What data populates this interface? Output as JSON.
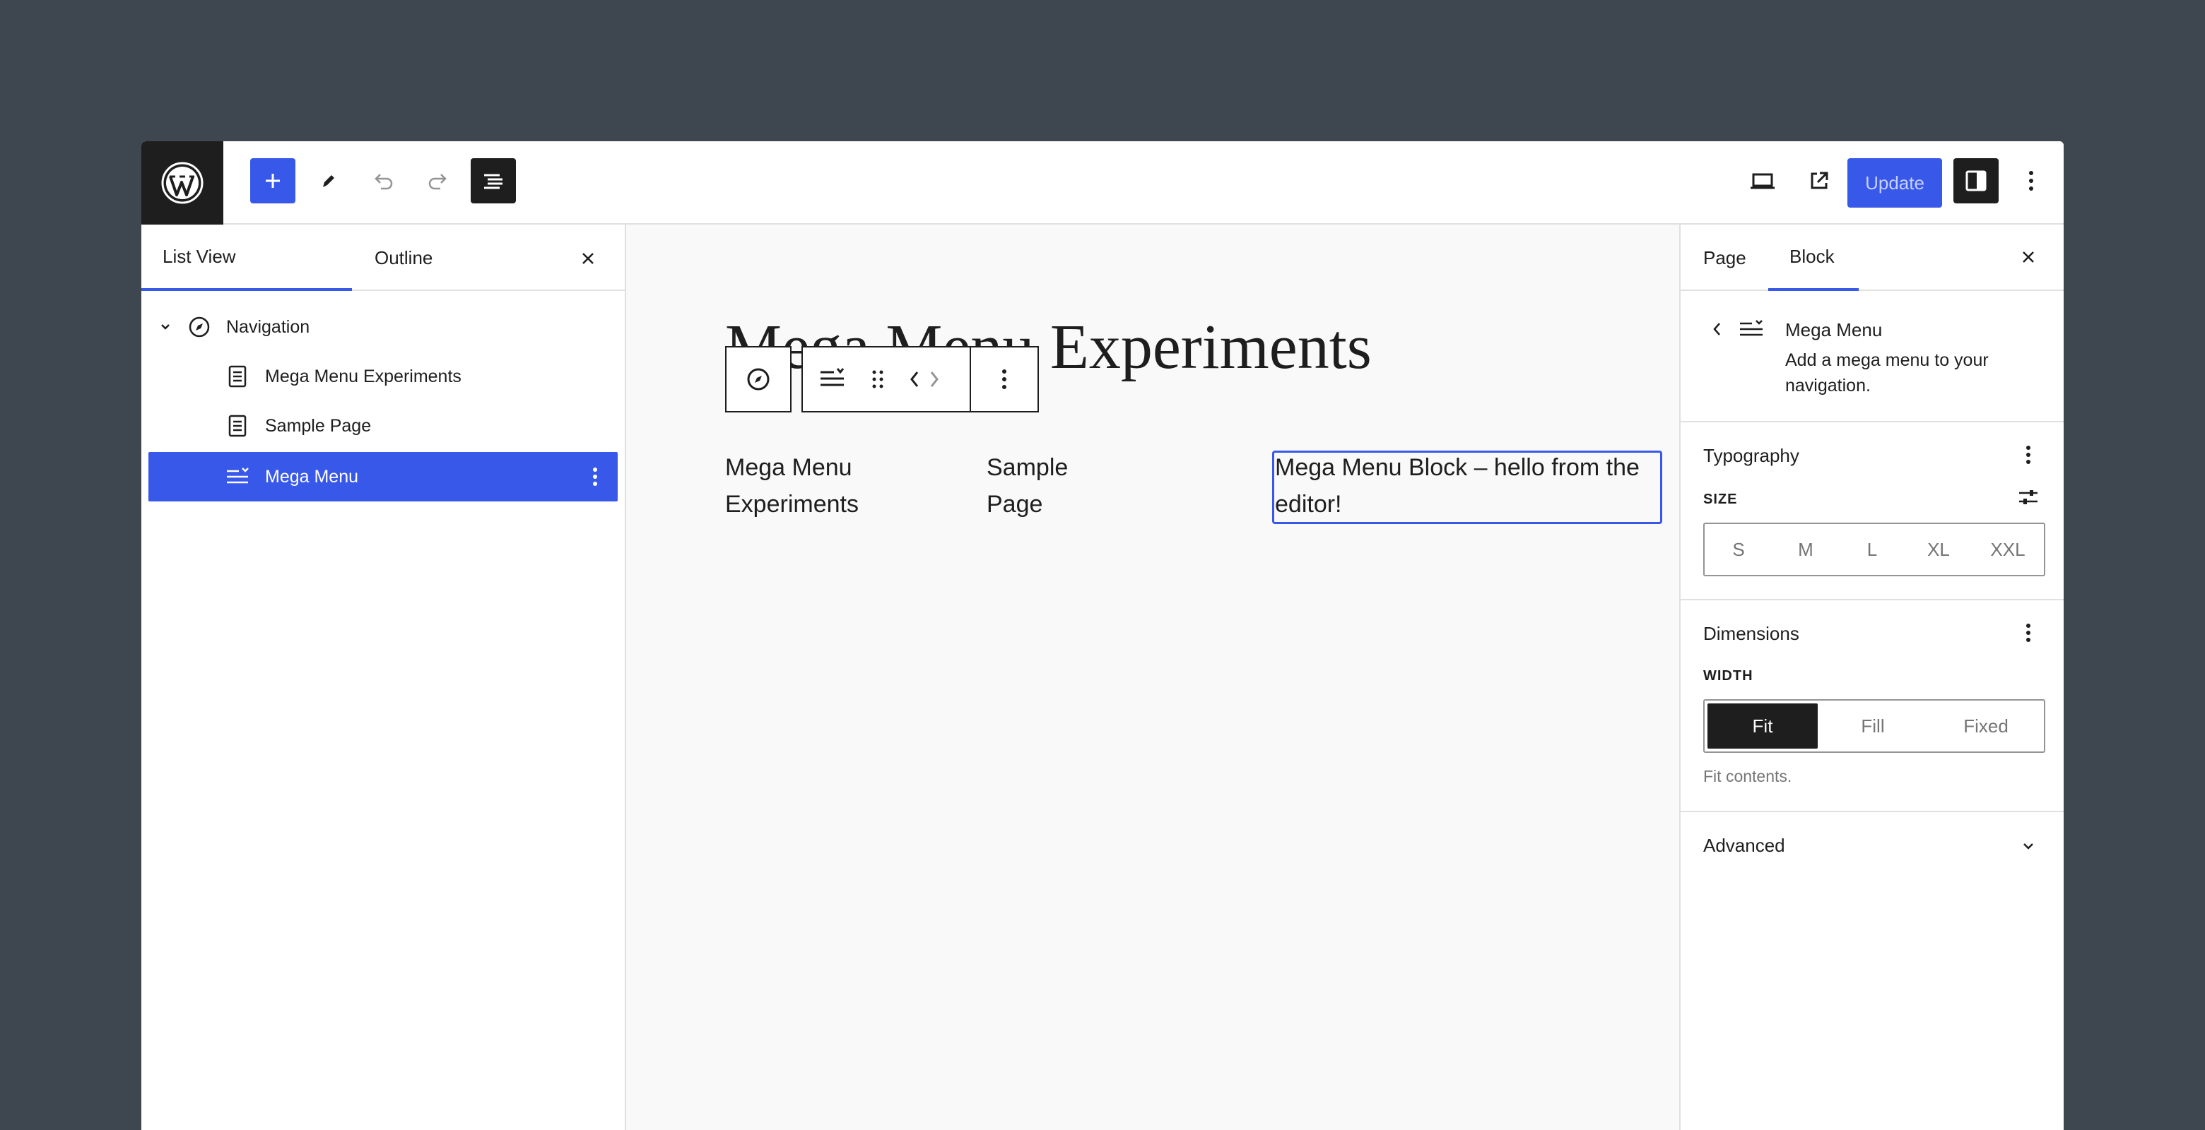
{
  "colors": {
    "accent": "#3858e9",
    "dark": "#1e1e1e",
    "backdrop": "#3e464f"
  },
  "topbar": {
    "icons": [
      "wordpress-logo-icon",
      "plus-icon",
      "pencil-icon",
      "undo-icon",
      "redo-icon",
      "document-overview-icon",
      "laptop-icon",
      "external-link-icon",
      "sidebar-icon",
      "more-vertical-icon"
    ],
    "update_label": "Update"
  },
  "left_panel": {
    "tabs": [
      {
        "label": "List View",
        "active": true
      },
      {
        "label": "Outline",
        "active": false
      }
    ],
    "items": [
      {
        "label": "Navigation",
        "icon": "navigation-compass-icon"
      },
      {
        "label": "Mega Menu Experiments",
        "icon": "page-icon"
      },
      {
        "label": "Sample Page",
        "icon": "page-icon"
      },
      {
        "label": "Mega Menu",
        "icon": "mega-menu-icon",
        "selected": true
      }
    ]
  },
  "canvas": {
    "page_title": "Mega Menu Experiments",
    "nav": [
      {
        "line1": "Mega Menu",
        "line2": "Experiments"
      },
      {
        "line1": "Sample",
        "line2": "Page"
      }
    ],
    "mega_block_text": "Mega Menu Block – hello from the editor!"
  },
  "right_panel": {
    "tabs": [
      {
        "label": "Page",
        "active": false
      },
      {
        "label": "Block",
        "active": true
      }
    ],
    "block": {
      "title": "Mega Menu",
      "description": "Add a mega menu to your navigation."
    },
    "typography": {
      "title": "Typography",
      "size_label": "SIZE",
      "sizes": [
        "S",
        "M",
        "L",
        "XL",
        "XXL"
      ]
    },
    "dimensions": {
      "title": "Dimensions",
      "width_label": "WIDTH",
      "options": [
        "Fit",
        "Fill",
        "Fixed"
      ],
      "selected": "Fit",
      "help": "Fit contents."
    },
    "advanced": {
      "title": "Advanced"
    }
  }
}
